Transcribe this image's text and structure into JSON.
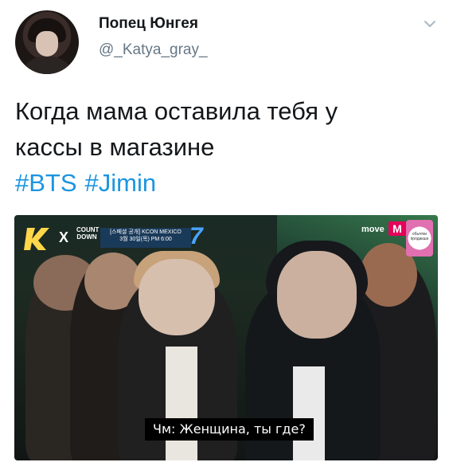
{
  "author": {
    "name": "Попец Юнгея",
    "handle": "@_Katya_gray_"
  },
  "tweet": {
    "text_line1": "Когда мама оставила тебя у",
    "text_line2": "кассы в магазине",
    "hashtags": [
      "#BTS",
      "#Jimin"
    ]
  },
  "media": {
    "broadcast_left": {
      "x": "X",
      "countdown": "COUNT DOWN",
      "info_line1": "[스페셜 공개] KCON MEXICO",
      "info_line2": "3월 30일(목) PM 6:00",
      "number": "7"
    },
    "broadcast_right": {
      "move": "move",
      "m": "M",
      "fan_label": "обьятки продакшн"
    },
    "subtitle": "Чм: Женщина, ты где?"
  },
  "colors": {
    "hashtag": "#1b95e0",
    "handle": "#657786",
    "text": "#14171a"
  },
  "icons": [
    "chevron-down-icon"
  ]
}
